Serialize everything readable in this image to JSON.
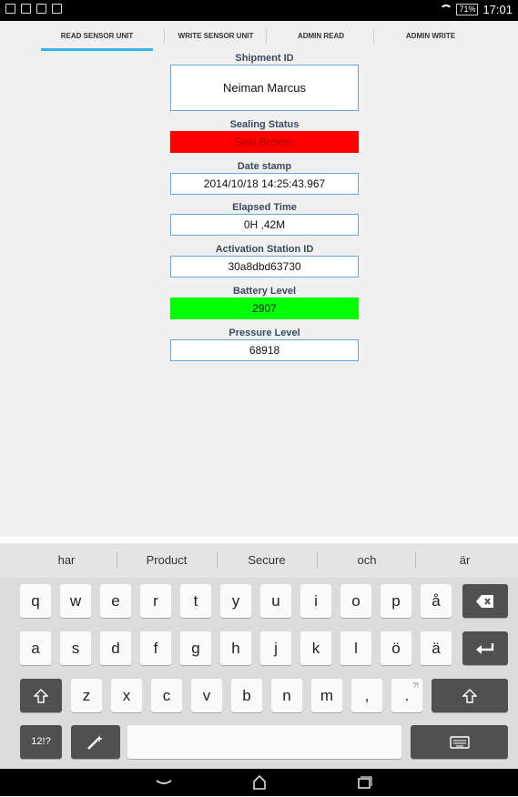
{
  "status_bar": {
    "battery": "71%",
    "time": "17:01"
  },
  "tabs": [
    {
      "label": "READ SENSOR UNIT",
      "active": true
    },
    {
      "label": "WRITE SENSOR UNIT",
      "active": false
    },
    {
      "label": "ADMIN READ",
      "active": false
    },
    {
      "label": "ADMIN WRITE",
      "active": false
    }
  ],
  "fields": {
    "shipment_id": {
      "label": "Shipment ID",
      "value": "Neiman Marcus"
    },
    "sealing_status": {
      "label": "Sealing Status",
      "value": "Seal Broken",
      "color": "#ff0000"
    },
    "date_stamp": {
      "label": "Date stamp",
      "value": "2014/10/18 14:25:43.967"
    },
    "elapsed_time": {
      "label": "Elapsed Time",
      "value": "0H ,42M"
    },
    "activation_station_id": {
      "label": "Activation Station ID",
      "value": "30a8dbd63730"
    },
    "battery_level": {
      "label": "Battery Level",
      "value": "2907",
      "color": "#00ff00"
    },
    "pressure_level": {
      "label": "Pressure Level",
      "value": "68918"
    }
  },
  "keyboard": {
    "suggestions": [
      "har",
      "Product",
      "Secure",
      "och",
      "är"
    ],
    "row1": [
      "q",
      "w",
      "e",
      "r",
      "t",
      "y",
      "u",
      "i",
      "o",
      "p",
      "å"
    ],
    "row2": [
      "a",
      "s",
      "d",
      "f",
      "g",
      "h",
      "j",
      "k",
      "l",
      "ö",
      "ä"
    ],
    "row3": [
      "z",
      "x",
      "c",
      "v",
      "b",
      "n",
      "m",
      ",",
      "."
    ],
    "symbols_label": "12!?",
    "period_hint": "?!"
  }
}
